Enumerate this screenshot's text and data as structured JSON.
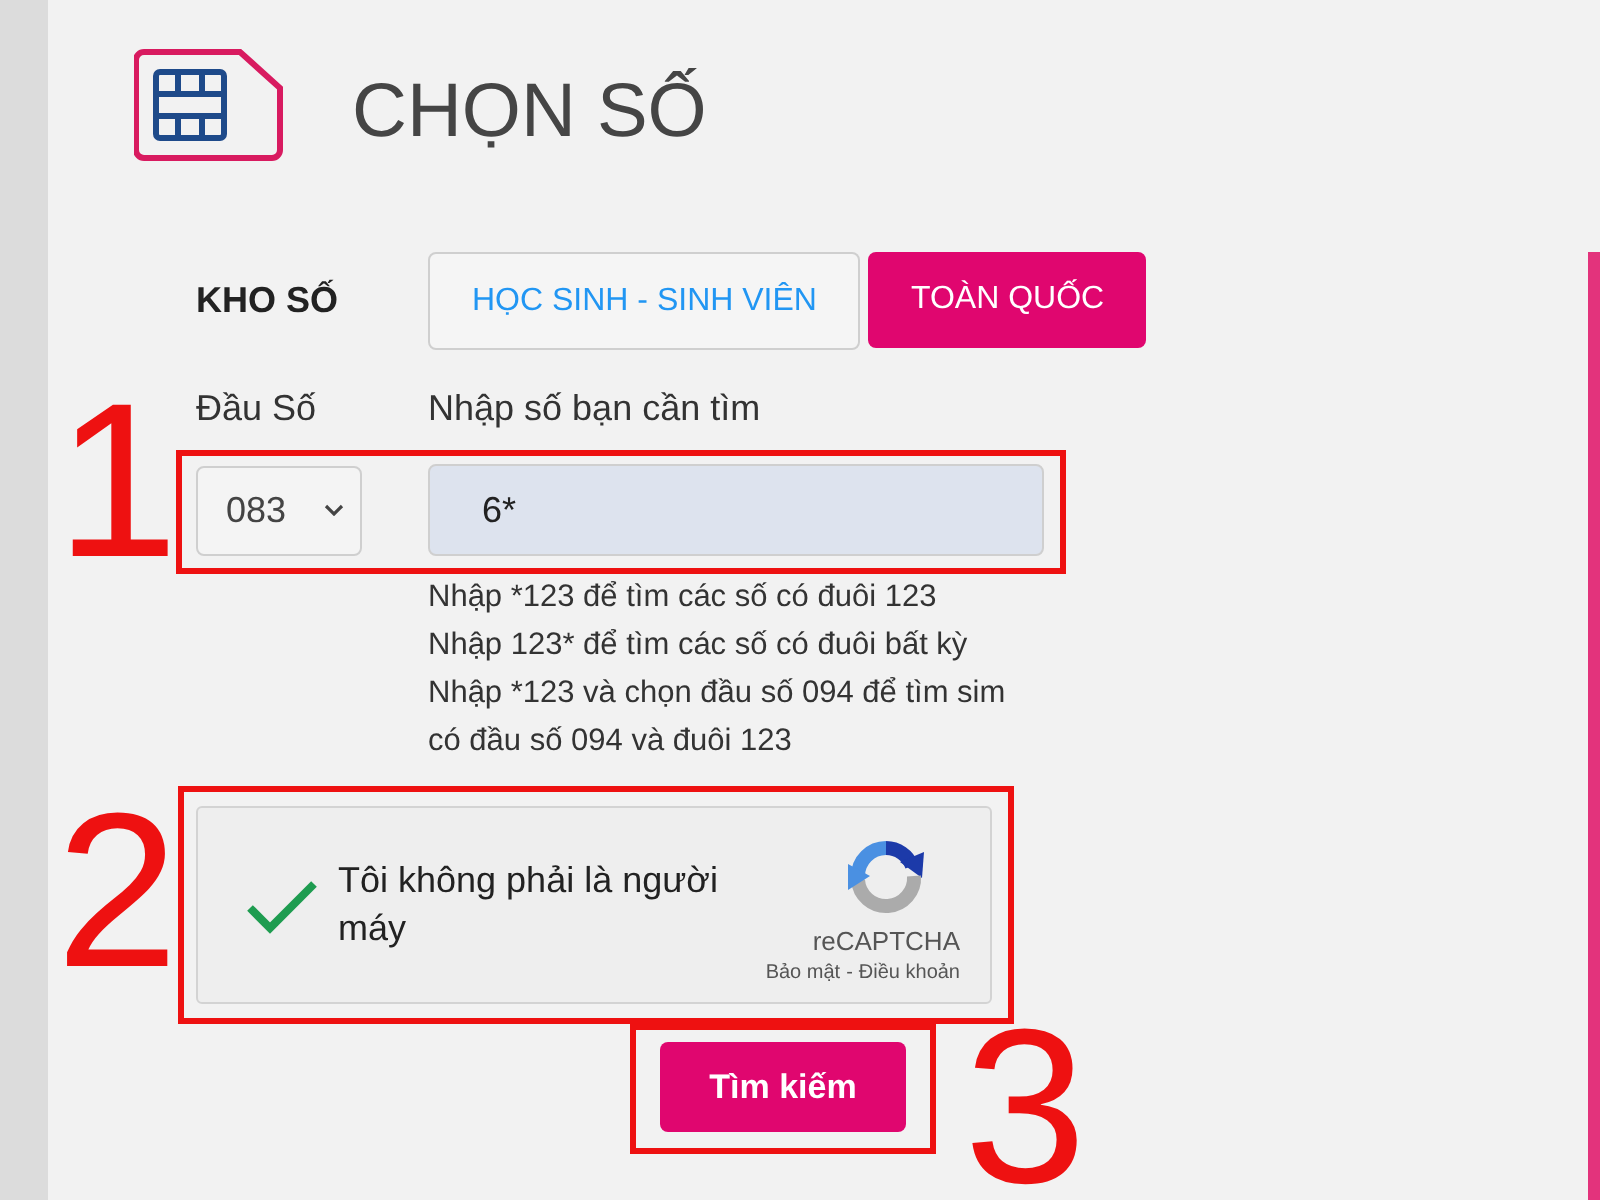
{
  "page": {
    "title": "CHỌN SỐ"
  },
  "number_store": {
    "label": "KHO SỐ",
    "tabs": [
      {
        "label": "HỌC SINH - SINH VIÊN",
        "selected": false
      },
      {
        "label": "TOÀN QUỐC",
        "selected": true
      }
    ]
  },
  "prefix": {
    "label": "Đầu Số",
    "value": "083"
  },
  "search": {
    "label": "Nhập số bạn cần tìm",
    "value": "6*"
  },
  "hints": [
    "Nhập *123 để tìm các số có đuôi 123",
    "Nhập 123* để tìm các số có đuôi bất kỳ",
    "Nhập *123 và chọn đầu số 094 để tìm sim có đầu số 094 và đuôi 123"
  ],
  "captcha": {
    "label": "Tôi không phải là người máy",
    "checked": true,
    "brand": "reCAPTCHA",
    "links": [
      "Bảo mật",
      "Điều khoản"
    ],
    "separator": "-"
  },
  "search_button": {
    "label": "Tìm kiếm"
  },
  "annotations": [
    {
      "label": "1"
    },
    {
      "label": "2"
    },
    {
      "label": "3"
    }
  ]
}
